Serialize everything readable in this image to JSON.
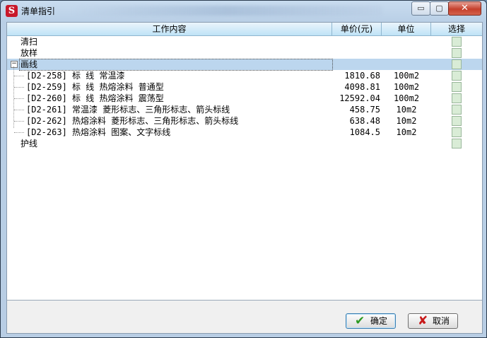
{
  "window": {
    "title": "清单指引",
    "app_icon_letter": "S",
    "minimize_glyph": "▭",
    "maximize_glyph": "▢",
    "close_glyph": "✕"
  },
  "table": {
    "headers": {
      "work": "工作内容",
      "price": "单价(元)",
      "unit": "单位",
      "select": "选择"
    },
    "groups": [
      {
        "label": "清扫"
      },
      {
        "label": "放样"
      },
      {
        "label": "画线",
        "expander": "−"
      },
      {
        "label": "护线"
      }
    ],
    "items": [
      {
        "name": "[D2-258] 标   线 常温漆",
        "price": "1810.68",
        "unit": "100m2"
      },
      {
        "name": "[D2-259] 标   线 热熔涂料 普通型",
        "price": "4098.81",
        "unit": "100m2"
      },
      {
        "name": "[D2-260] 标   线 热熔涂料 震荡型",
        "price": "12592.04",
        "unit": "100m2"
      },
      {
        "name": "[D2-261] 常温漆 菱形标志、三角形标志、箭头标线",
        "price": "458.75",
        "unit": "10m2"
      },
      {
        "name": "[D2-262] 热熔涂料 菱形标志、三角形标志、箭头标线",
        "price": "638.48",
        "unit": "10m2"
      },
      {
        "name": "[D2-263] 热熔涂料 图案、文字标线",
        "price": "1084.5",
        "unit": "10m2"
      }
    ]
  },
  "buttons": {
    "ok": "确定",
    "ok_icon": "✔",
    "cancel": "取消",
    "cancel_icon": "✘"
  },
  "colors": {
    "header_bg": "#bfe3f6",
    "selected_row": "#bcd6ee",
    "checkbox": "#d9ecd6"
  }
}
